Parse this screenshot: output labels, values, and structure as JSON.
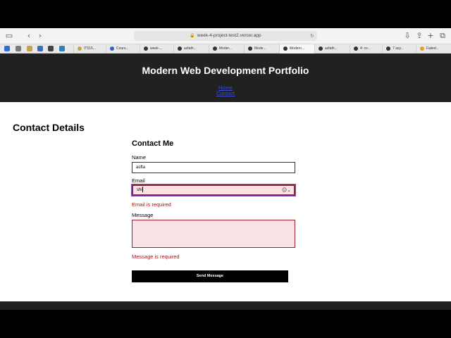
{
  "browser": {
    "url": "week-4-project-test2.vercel.app",
    "tabs": [
      {
        "label": ""
      },
      {
        "label": ""
      },
      {
        "label": "IT516..."
      },
      {
        "label": "Cours..."
      },
      {
        "label": "week-..."
      },
      {
        "label": "asfath..."
      },
      {
        "label": "Moder..."
      },
      {
        "label": "Mode..."
      },
      {
        "label": "Modern..."
      },
      {
        "label": "asfath..."
      },
      {
        "label": "4: co..."
      },
      {
        "label": "7 asy..."
      },
      {
        "label": "Failed..."
      }
    ],
    "icons": {
      "sidebar": "sidebar-icon",
      "back": "‹",
      "forward": "›",
      "lock": "🔒",
      "reload": "↻",
      "download": "⇩",
      "share": "⇪",
      "new_tab": "+",
      "tab_overview": "⧉"
    }
  },
  "header": {
    "title": "Modern Web Development Portfolio",
    "nav": {
      "home": "Home",
      "contact": "Contact"
    }
  },
  "main": {
    "section_title": "Contact Details",
    "form": {
      "title": "Contact Me",
      "name_label": "Name",
      "name_value": "asfta",
      "email_label": "Email",
      "email_value": "shi",
      "email_error": "Email is required",
      "message_label": "Message",
      "message_value": "",
      "message_error": "Message is required",
      "submit_label": "Send Message"
    }
  },
  "colors": {
    "header_bg": "#212121",
    "error_text": "#a1161b",
    "error_field_bg": "#fbe2e4",
    "link": "#3b4cd1"
  }
}
